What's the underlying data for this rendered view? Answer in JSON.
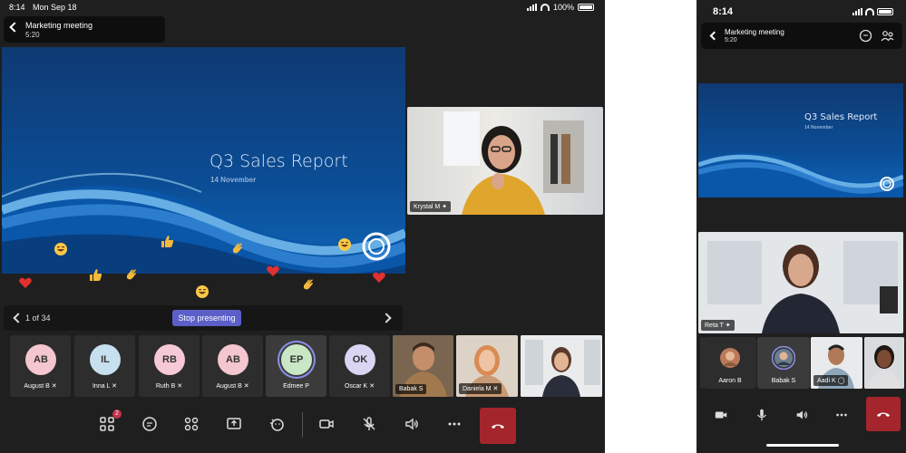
{
  "ipad": {
    "status": {
      "time": "8:14",
      "date": "Mon Sep 18",
      "battery": "100%"
    },
    "meeting": {
      "title": "Marketing meeting",
      "duration": "5:20"
    },
    "slide": {
      "title": "Q3 Sales Report",
      "date": "14 November"
    },
    "slide_controls": {
      "page": "1 of 34",
      "stop_label": "Stop presenting"
    },
    "pinned_video": {
      "name": "Krystal M"
    },
    "participants": [
      {
        "initials": "AB",
        "name": "August B",
        "color": "#f4c6cf"
      },
      {
        "initials": "IL",
        "name": "Inna L",
        "color": "#c7e0f0"
      },
      {
        "initials": "RB",
        "name": "Ruth B",
        "color": "#f6c9d6"
      },
      {
        "initials": "AB",
        "name": "August B",
        "color": "#f4c6cf"
      },
      {
        "initials": "EP",
        "name": "Edmee P",
        "color": "#c9e6c5"
      },
      {
        "initials": "OK",
        "name": "Oscar K",
        "color": "#d9d5f2"
      }
    ],
    "video_tiles": [
      {
        "name": "Babak S"
      },
      {
        "name": "Daniela M"
      },
      {
        "name": ""
      }
    ],
    "toolbar": {
      "apps_badge": "2"
    }
  },
  "phone": {
    "status": {
      "time": "8:14"
    },
    "meeting": {
      "title": "Marketing meeting",
      "duration": "5:20"
    },
    "slide": {
      "title": "Q3 Sales Report",
      "date": "14 November"
    },
    "pinned_video": {
      "name": "Reta T"
    },
    "tiles": [
      {
        "name": "Aaron B"
      },
      {
        "name": "Babak S"
      },
      {
        "name": "Aadi K"
      },
      {
        "name": ""
      }
    ]
  },
  "colors": {
    "accent": "#5b5fc7",
    "hangup": "#a4262c",
    "background": "#1f1f1f"
  }
}
